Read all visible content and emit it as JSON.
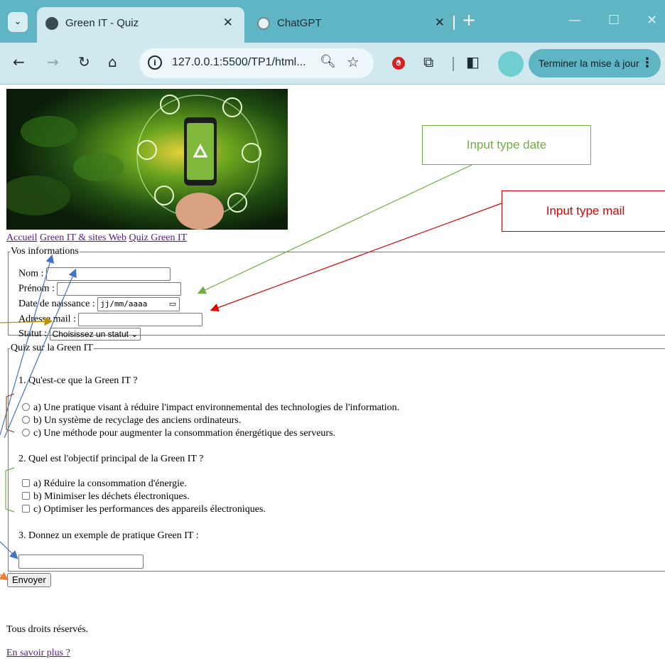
{
  "browser": {
    "tabs": [
      {
        "title": "Green IT - Quiz",
        "active": true
      },
      {
        "title": "ChatGPT",
        "active": false
      }
    ],
    "url": "127.0.0.1:5500/TP1/html...",
    "update_button": "Terminer la mise à jour"
  },
  "nav": {
    "links": [
      "Accueil",
      "Green IT & sites Web",
      "Quiz Green IT"
    ]
  },
  "info": {
    "legend": "Vos informations",
    "nom_label": "Nom :",
    "prenom_label": "Prénom :",
    "date_label": "Date de naissance :",
    "date_placeholder": "jj/mm/aaaa",
    "mail_label": "Adresse mail :",
    "statut_label": "Statut :",
    "statut_selected": "Choisissez un statut"
  },
  "quiz": {
    "legend": "Quiz sur la Green IT",
    "q1": "1. Qu'est-ce que la Green IT ?",
    "q1_options": [
      "a) Une pratique visant à réduire l'impact environnemental des technologies de l'information.",
      "b) Un système de recyclage des anciens ordinateurs.",
      "c) Une méthode pour augmenter la consommation énergétique des serveurs."
    ],
    "q2": "2. Quel est l'objectif principal de la Green IT ?",
    "q2_options": [
      "a) Réduire la consommation d'énergie.",
      "b) Minimiser les déchets électroniques.",
      "c) Optimiser les performances des appareils électroniques."
    ],
    "q3": "3. Donnez un exemple de pratique Green IT :"
  },
  "submit_label": "Envoyer",
  "footer": {
    "rights": "Tous droits réservés.",
    "more_link": "En savoir plus ?"
  },
  "annotations": {
    "date_callout": "Input type date",
    "mail_callout": "Input type mail"
  },
  "colors": {
    "tabstrip": "#5fb5c4",
    "toolbar": "#cfe9ee",
    "link_visited": "#551a8b",
    "annotation_green": "#70ad47",
    "annotation_red": "#e00000",
    "annotation_blue": "#4472c4",
    "annotation_gold": "#bf9000",
    "annotation_orange": "#ed7d31"
  }
}
